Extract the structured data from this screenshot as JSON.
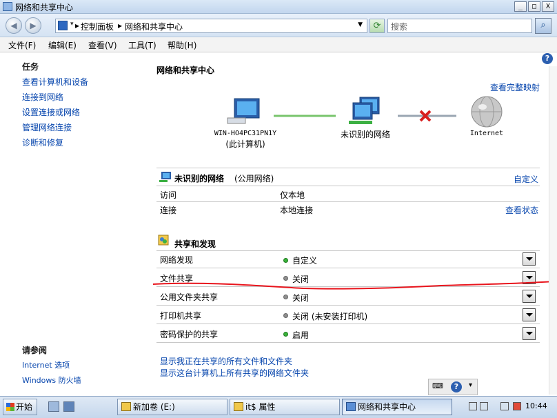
{
  "window": {
    "title": "网络和共享中心",
    "controls": {
      "minimize": "_",
      "maximize": "□",
      "close": "X"
    }
  },
  "address": {
    "crumbs": [
      "控制面板",
      "网络和共享中心"
    ],
    "separator": "▸",
    "search_placeholder": "搜索",
    "icons": [
      "back-arrow",
      "forward-arrow",
      "control-panel-icon",
      "refresh-icon",
      "search-icon"
    ]
  },
  "menu": [
    "文件(F)",
    "编辑(E)",
    "查看(V)",
    "工具(T)",
    "帮助(H)"
  ],
  "help_icon": "?",
  "tasks": {
    "heading": "任务",
    "items": [
      "查看计算机和设备",
      "连接到网络",
      "设置连接或网络",
      "管理网络连接",
      "诊断和修复"
    ]
  },
  "see_also": {
    "heading": "请参阅",
    "items": [
      "Internet 选项",
      "Windows 防火墙"
    ]
  },
  "main": {
    "title": "网络和共享中心",
    "view_full_map": "查看完整映射",
    "map": {
      "computer_name": "WIN-HO4PC31PN1Y",
      "computer_sub": "(此计算机)",
      "network": "未识别的网络",
      "internet": "Internet"
    }
  },
  "network_section": {
    "name": "未识别的网络",
    "type": "(公用网络)",
    "customize": "自定义",
    "rows": [
      {
        "label": "访问",
        "value": "仅本地"
      },
      {
        "label": "连接",
        "value": "本地连接",
        "action": "查看状态"
      }
    ]
  },
  "sharing": {
    "heading": "共享和发现",
    "rows": [
      {
        "label": "网络发现",
        "status": "自定义",
        "state": "on"
      },
      {
        "label": "文件共享",
        "status": "关闭",
        "state": "off"
      },
      {
        "label": "公用文件夹共享",
        "status": "关闭",
        "state": "off"
      },
      {
        "label": "打印机共享",
        "status": "关闭 (未安装打印机)",
        "state": "off"
      },
      {
        "label": "密码保护的共享",
        "status": "启用",
        "state": "on"
      }
    ],
    "links": [
      "显示我正在共享的所有文件和文件夹",
      "显示这台计算机上所有共享的网络文件夹"
    ]
  },
  "colors": {
    "link": "#0645ad",
    "annotation": "#e8141c",
    "status_on": "#39b23a",
    "status_off": "#8f8f8f"
  },
  "taskbar": {
    "start": "开始",
    "buttons": [
      "新加卷 (E:)",
      "it$ 属性",
      "网络和共享中心"
    ],
    "clock": "10:44"
  }
}
